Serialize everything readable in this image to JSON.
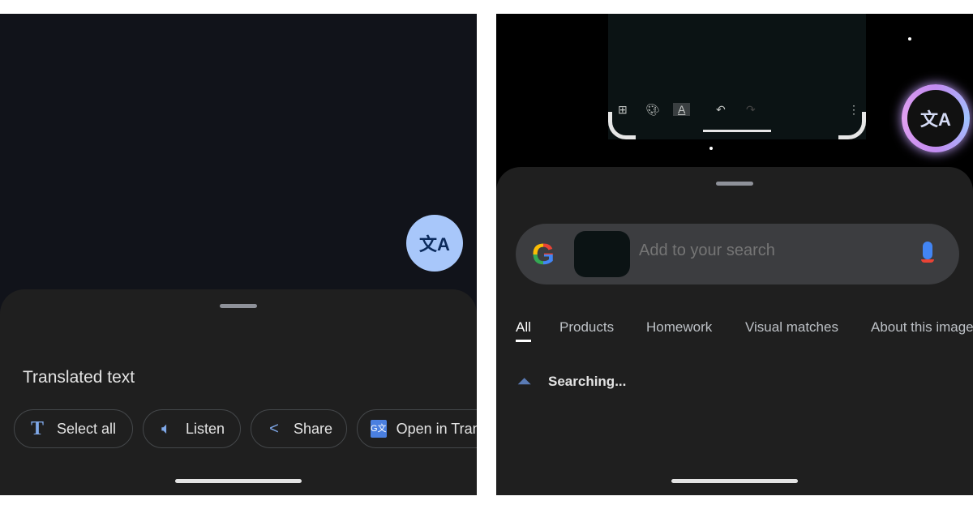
{
  "left": {
    "fab_icon": "translate-icon",
    "heading": "Translated text",
    "chips": [
      {
        "icon": "text-select-icon",
        "label": "Select all"
      },
      {
        "icon": "speaker-icon",
        "label": "Listen"
      },
      {
        "icon": "share-icon",
        "label": "Share"
      },
      {
        "icon": "google-translate-icon",
        "label": "Open in Translate"
      }
    ]
  },
  "right": {
    "toolbar_icons": [
      "add-box-icon",
      "palette-icon",
      "text-format-icon",
      "undo-icon",
      "redo-icon",
      "more-vert-icon"
    ],
    "fab_icon": "translate-icon",
    "search": {
      "placeholder": "Add to your search"
    },
    "tabs": [
      "All",
      "Products",
      "Homework",
      "Visual matches",
      "About this image"
    ],
    "active_tab": "All",
    "status": "Searching..."
  },
  "colors": {
    "accent": "#a8c7fa",
    "icon_blue": "#7fa8e8"
  }
}
